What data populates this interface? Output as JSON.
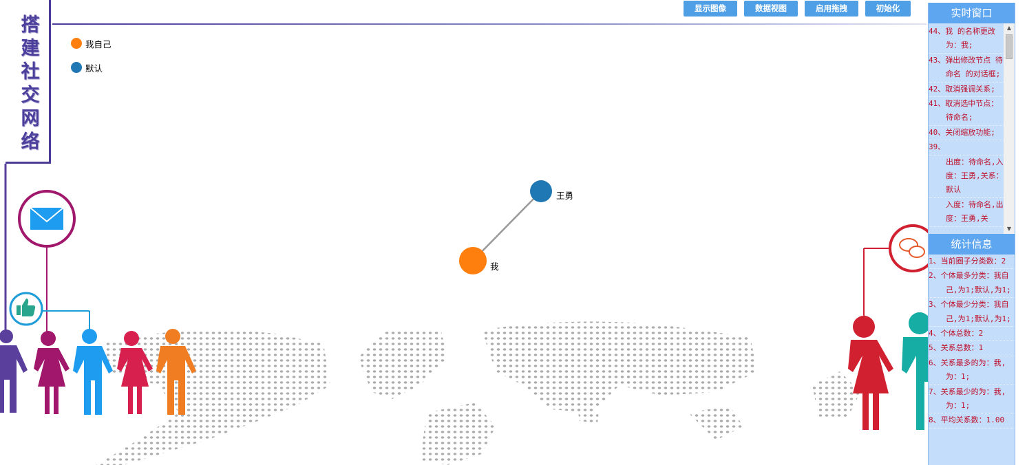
{
  "toolbar": {
    "buttons": [
      "显示图像",
      "数据视图",
      "启用拖拽",
      "初始化"
    ]
  },
  "title": {
    "chars": [
      "搭",
      "建",
      "社",
      "交",
      "网",
      "络"
    ]
  },
  "legend": [
    {
      "label": "我自己",
      "color": "#ff7f0e"
    },
    {
      "label": "默认",
      "color": "#1f77b4"
    }
  ],
  "graph": {
    "nodes": [
      {
        "id": "wo",
        "label": "我",
        "color": "#ff7f0e"
      },
      {
        "id": "wangyong",
        "label": "王勇",
        "color": "#1f77b4"
      }
    ],
    "edges": [
      {
        "source": "wo",
        "target": "wangyong"
      }
    ]
  },
  "realtime_panel": {
    "title": "实时窗口",
    "lines": [
      "44、我 的名称更改为：我;",
      "43、弹出修改节点 待命名 的对话框;",
      "42、取消强调关系;",
      "41、取消选中节点：待命名;",
      "40、关闭缩放功能;",
      "39、",
      "出度：待命名,入度：王勇,关系：默认",
      "入度：待命名,出度：王勇,关"
    ]
  },
  "stats_panel": {
    "title": "统计信息",
    "lines": [
      "1、当前圈子分类数：2",
      "2、个体最多分类：我自己,为1;默认,为1;",
      "3、个体最少分类：我自己,为1;默认,为1;",
      "4、个体总数：2",
      "5、关系总数：1",
      "6、关系最多的为：我,为：1;",
      "7、关系最少的为：我,为：1;",
      "8、平均关系数：1.00"
    ]
  },
  "colors": {
    "accent": "#4f9fe6",
    "panel_bg": "#c3ddfb",
    "panel_head": "#5ea6ef",
    "log_text": "#c0102a",
    "title": "#4b3f9c"
  }
}
